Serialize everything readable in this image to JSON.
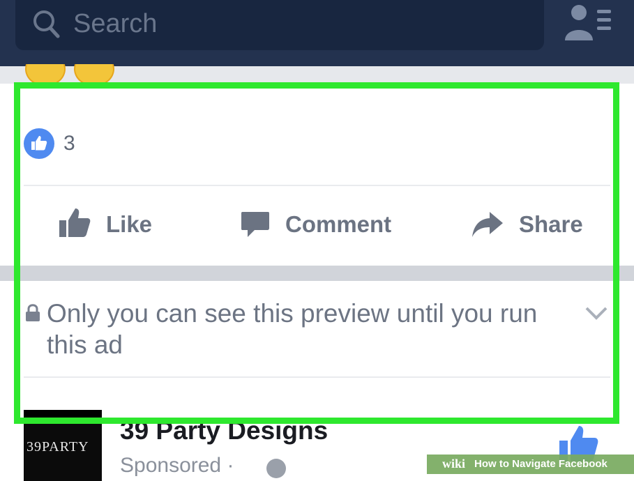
{
  "header": {
    "search_placeholder": "Search",
    "search_icon": "search-icon",
    "friends_icon": "friend-requests-icon"
  },
  "reactions_row": {
    "emojis": [
      "wow-emoji",
      "haha-emoji"
    ]
  },
  "post": {
    "like_count": "3",
    "actions": {
      "like": "Like",
      "comment": "Comment",
      "share": "Share"
    },
    "privacy_notice": "Only you can see this preview until you run this ad"
  },
  "ad": {
    "page_name": "39 Party Designs",
    "sponsored": "Sponsored · ",
    "logo_text": "39PARTY"
  },
  "watermark": {
    "brand": "wiki",
    "title": "How to Navigate Facebook"
  },
  "colors": {
    "header_bg": "#23324f",
    "highlight": "#2ee82e",
    "like_blue": "#4f8af0",
    "action_gray": "#6b7382"
  }
}
